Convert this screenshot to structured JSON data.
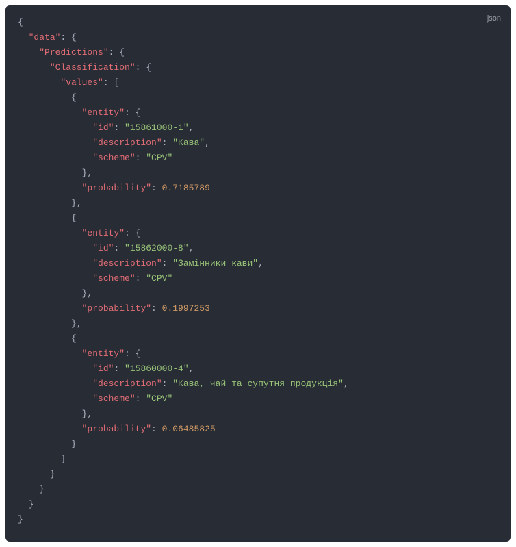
{
  "lang_label": "json",
  "k_data": "\"data\"",
  "k_predictions": "\"Predictions\"",
  "k_classification": "\"Classification\"",
  "k_values": "\"values\"",
  "k_entity": "\"entity\"",
  "k_id": "\"id\"",
  "k_description": "\"description\"",
  "k_scheme": "\"scheme\"",
  "k_probability": "\"probability\"",
  "v_id1": "\"15861000-1\"",
  "v_desc1": "\"Кава\"",
  "v_scheme": "\"CPV\"",
  "v_prob1": "0.7185789",
  "v_id2": "\"15862000-8\"",
  "v_desc2": "\"Замінники кави\"",
  "v_prob2": "0.1997253",
  "v_id3": "\"15860000-4\"",
  "v_desc3": "\"Кава, чай та супутня продукція\"",
  "v_prob3": "0.06485825"
}
